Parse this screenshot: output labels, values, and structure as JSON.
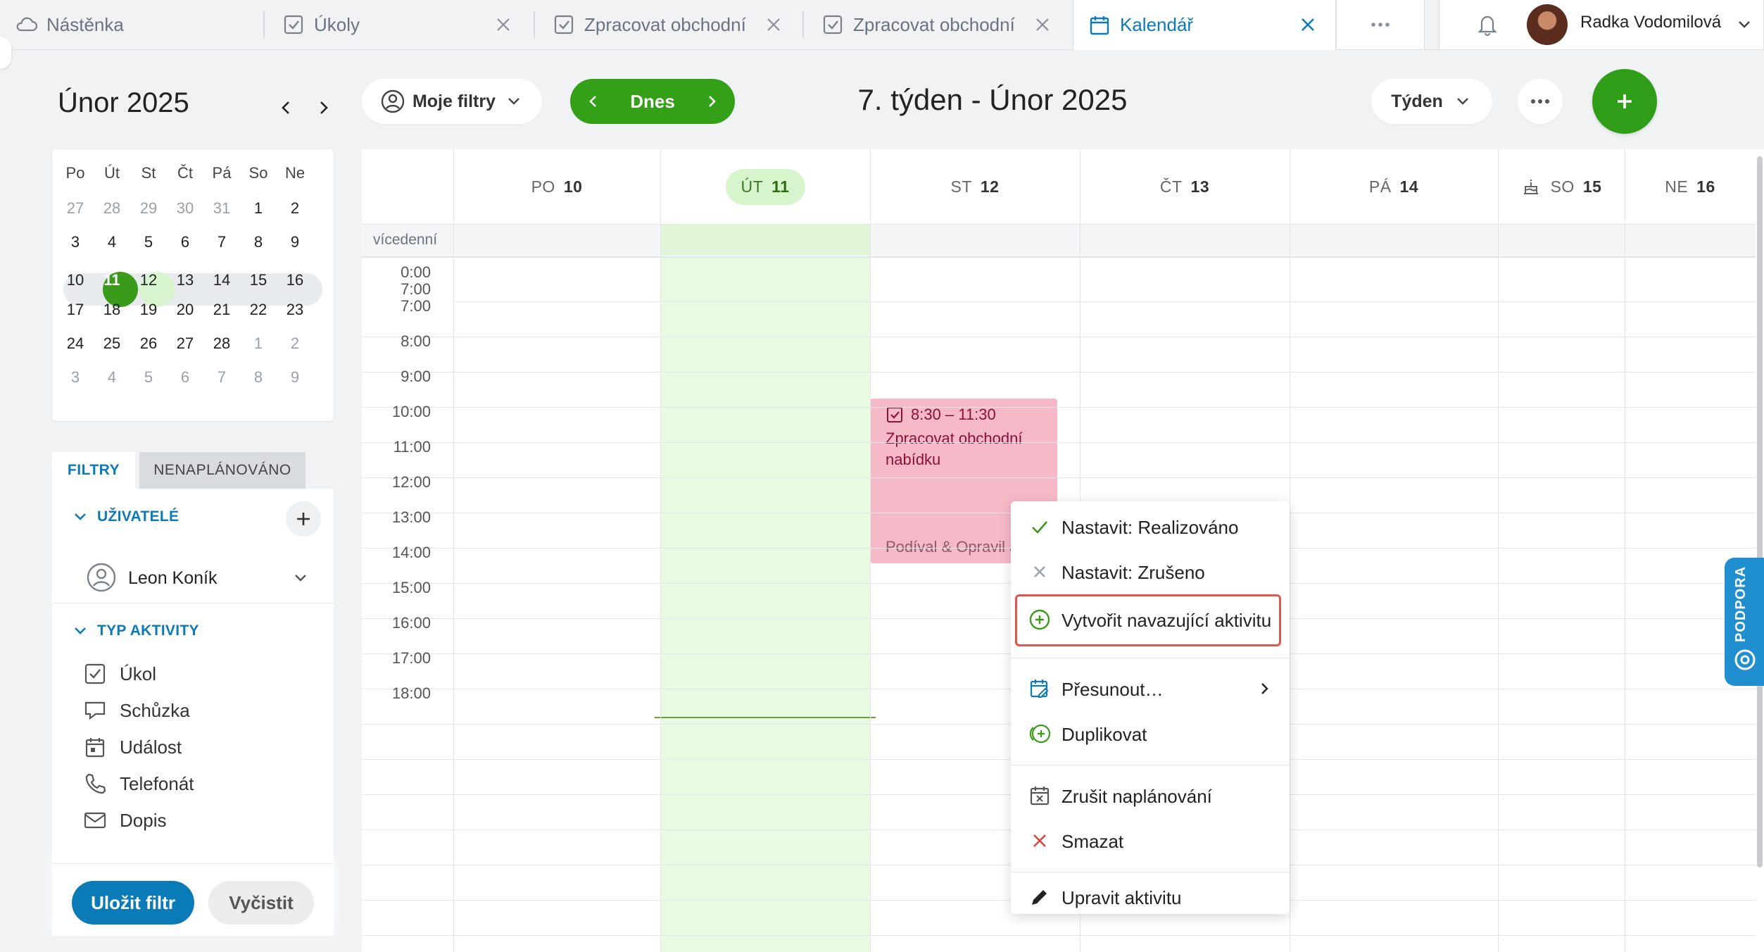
{
  "tabs": [
    {
      "label": "Nástěnka",
      "icon": "cloud-icon"
    },
    {
      "label": "Úkoly",
      "icon": "task-check-icon"
    },
    {
      "label": "Zpracovat obchodní",
      "icon": "task-check-icon"
    },
    {
      "label": "Zpracovat obchodní",
      "icon": "task-check-icon"
    },
    {
      "label": "Kalendář",
      "icon": "calendar-icon",
      "active": true
    }
  ],
  "user": {
    "name": "Radka Vodomilová"
  },
  "minical": {
    "title": "Únor 2025",
    "weekdays": [
      "Po",
      "Út",
      "St",
      "Čt",
      "Pá",
      "So",
      "Ne"
    ],
    "weeks": [
      [
        "27",
        "28",
        "29",
        "30",
        "31",
        "1",
        "2"
      ],
      [
        "3",
        "4",
        "5",
        "6",
        "7",
        "8",
        "9"
      ],
      [
        "10",
        "11",
        "12",
        "13",
        "14",
        "15",
        "16"
      ],
      [
        "17",
        "18",
        "19",
        "20",
        "21",
        "22",
        "23"
      ],
      [
        "24",
        "25",
        "26",
        "27",
        "28",
        "1",
        "2"
      ],
      [
        "3",
        "4",
        "5",
        "6",
        "7",
        "8",
        "9"
      ]
    ],
    "today": "11",
    "selected": "12"
  },
  "filter_tabs": {
    "filters": "FILTRY",
    "unscheduled": "NENAPLÁNOVÁNO"
  },
  "users_section": {
    "title": "UŽIVATELÉ",
    "user": "Leon Koník"
  },
  "activity_section": {
    "title": "TYP AKTIVITY",
    "items": [
      {
        "label": "Úkol",
        "icon": "task-check-icon"
      },
      {
        "label": "Schůzka",
        "icon": "meeting-icon"
      },
      {
        "label": "Událost",
        "icon": "event-calendar-icon"
      },
      {
        "label": "Telefonát",
        "icon": "phone-icon"
      },
      {
        "label": "Dopis",
        "icon": "mail-icon"
      }
    ]
  },
  "buttons": {
    "save_filter": "Uložit filtr",
    "clear": "Vyčistit"
  },
  "toolbar": {
    "my_filters": "Moje filtry",
    "today": "Dnes",
    "week_title": "7. týden - Únor 2025",
    "view": "Týden"
  },
  "calendar": {
    "days": [
      {
        "abbr": "PO",
        "num": "10"
      },
      {
        "abbr": "ÚT",
        "num": "11"
      },
      {
        "abbr": "ST",
        "num": "12"
      },
      {
        "abbr": "ČT",
        "num": "13"
      },
      {
        "abbr": "PÁ",
        "num": "14"
      },
      {
        "abbr": "SO",
        "num": "15"
      },
      {
        "abbr": "NE",
        "num": "16"
      }
    ],
    "multiday_label": "vícedenní",
    "times": [
      "0:00",
      "7:00",
      "7:00",
      "8:00",
      "9:00",
      "10:00",
      "11:00",
      "12:00",
      "13:00",
      "14:00",
      "15:00",
      "16:00",
      "17:00",
      "18:00"
    ]
  },
  "event": {
    "time": "8:30 – 11:30",
    "title": "Zpracovat obchodní nabídku",
    "people": "Podíval & Opravil a"
  },
  "context_menu": {
    "items": [
      {
        "label": "Nastavit: Realizováno",
        "icon": "check-icon"
      },
      {
        "label": "Nastavit: Zrušeno",
        "icon": "cross-icon"
      },
      {
        "label": "Vytvořit navazující aktivitu",
        "icon": "plus-circle-icon"
      },
      {
        "label": "Přesunout…",
        "icon": "calendar-move-icon"
      },
      {
        "label": "Duplikovat",
        "icon": "duplicate-icon"
      },
      {
        "label": "Zrušit naplánování",
        "icon": "calendar-x-icon"
      },
      {
        "label": "Smazat",
        "icon": "delete-x-icon"
      },
      {
        "label": "Upravit aktivitu",
        "icon": "pencil-icon"
      }
    ]
  },
  "support": {
    "label": "PODPORA"
  },
  "colors": {
    "accent": "#0b7bb8",
    "green": "#33a018",
    "event": "#f6b9c8",
    "highlight": "#e2574c"
  }
}
